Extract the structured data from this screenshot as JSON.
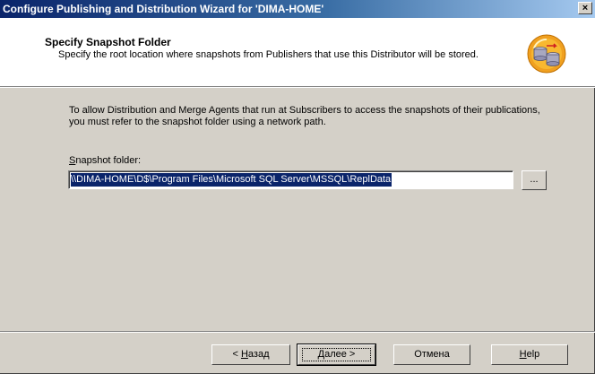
{
  "window": {
    "title": "Configure Publishing and Distribution Wizard for 'DIMA-HOME'",
    "close_label": "×"
  },
  "header": {
    "title": "Specify Snapshot Folder",
    "description": "Specify the root location where snapshots from Publishers that use this Distributor will be stored.",
    "icon": "database-replication-icon"
  },
  "body": {
    "info": "To allow Distribution and Merge Agents that run at Subscribers to access the snapshots of their publications, you must refer to the snapshot folder using a network path.",
    "snapshot_label_prefix": "S",
    "snapshot_label_rest": "napshot folder:",
    "snapshot_value": "\\\\DIMA-HOME\\D$\\Program Files\\Microsoft SQL Server\\MSSQL\\ReplData",
    "browse_label": "..."
  },
  "buttons": {
    "back_prefix": "< ",
    "back_accel": "Н",
    "back_rest": "азад",
    "next_accel": "Д",
    "next_rest": "алее >",
    "cancel": "Отмена",
    "help_accel": "H",
    "help_rest": "elp"
  },
  "colors": {
    "titlebar_start": "#0a246a",
    "titlebar_end": "#a6caf0",
    "face": "#d4d0c8",
    "selection": "#0a246a"
  }
}
